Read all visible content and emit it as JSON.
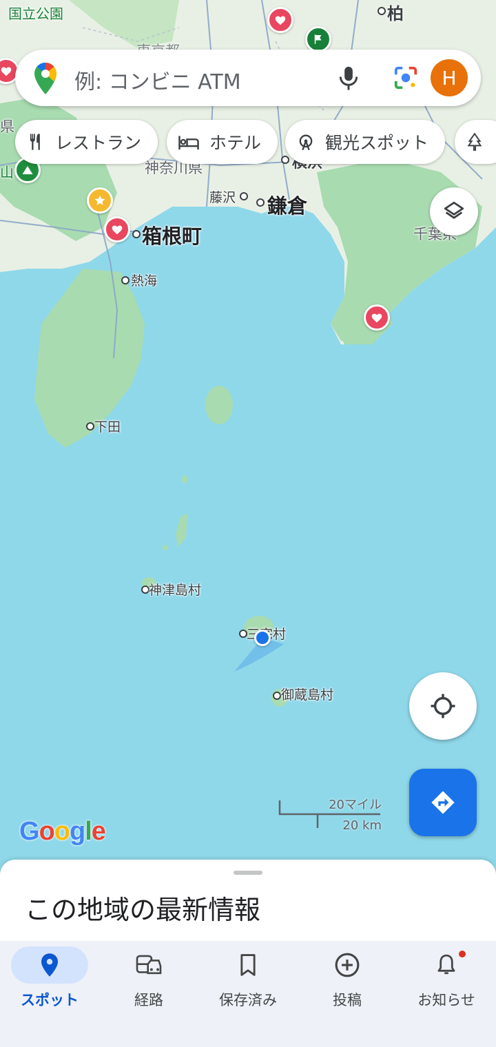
{
  "search": {
    "placeholder": "例: コンビニ ATM",
    "avatar_letter": "H"
  },
  "chips": [
    {
      "label": "レストラン",
      "icon": "restaurant-icon"
    },
    {
      "label": "ホテル",
      "icon": "hotel-icon"
    },
    {
      "label": "観光スポット",
      "icon": "attraction-icon"
    },
    {
      "label": "",
      "icon": "park-icon"
    }
  ],
  "map": {
    "labels": {
      "park_top": "国立公園",
      "kashiwa": "柏",
      "tokyo": "東京都",
      "kanagawa": "神奈川県",
      "yokohama": "横浜",
      "fujisawa": "藤沢",
      "kamakura": "鎌倉",
      "chiba": "千葉県",
      "hakone": "箱根町",
      "atami": "熱海",
      "shimoda": "下田",
      "kozushima": "神津島村",
      "miyake": "三宅村",
      "mikurajima": "御蔵島村",
      "ken_left": "県",
      "yama_left": "山"
    },
    "scale": {
      "miles": "20マイル",
      "km": "20 km"
    },
    "attribution": "Google"
  },
  "sheet": {
    "title": "この地域の最新情報"
  },
  "nav": [
    {
      "label": "スポット",
      "icon": "spot-pin-icon",
      "active": true
    },
    {
      "label": "経路",
      "icon": "commute-icon",
      "active": false
    },
    {
      "label": "保存済み",
      "icon": "bookmark-icon",
      "active": false
    },
    {
      "label": "投稿",
      "icon": "add-circle-icon",
      "active": false
    },
    {
      "label": "お知らせ",
      "icon": "bell-icon",
      "active": false
    }
  ],
  "colors": {
    "water": "#8fd8ea",
    "land": "#e8f0e5",
    "green": "#a8dbb0",
    "accent": "#1a73e8",
    "avatar": "#e8710a"
  }
}
